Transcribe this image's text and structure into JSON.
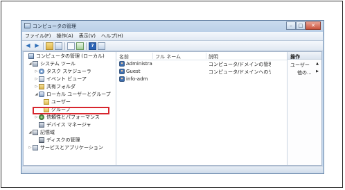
{
  "window": {
    "title": "コンピュータの管理"
  },
  "menu": [
    "ファイル(F)",
    "操作(A)",
    "表示(V)",
    "ヘルプ(H)"
  ],
  "tree": {
    "root": "コンピュータの管理 (ローカル)",
    "system_tools": "システム ツール",
    "task_scheduler": "タスク スケジューラ",
    "event_viewer": "イベント ビューア",
    "shared_folders": "共有フォルダ",
    "local_users_groups": "ローカル ユーザーとグループ",
    "users": "ユーザー",
    "groups": "グループ",
    "reliability": "信頼性とパフォーマンス",
    "device_manager": "デバイス マネージャ",
    "storage": "記憶域",
    "disk_management": "ディスクの管理",
    "services_apps": "サービスとアプリケーション"
  },
  "list": {
    "columns": [
      "名前",
      "フル ネーム",
      "説明"
    ],
    "rows": [
      {
        "name": "Administra...",
        "fullname": "",
        "description": "コンピュータ/ドメインの管理用..."
      },
      {
        "name": "Guest",
        "fullname": "",
        "description": "コンピュータ/ドメインへのゲス..."
      },
      {
        "name": "info-adm",
        "fullname": "",
        "description": ""
      }
    ]
  },
  "actions": {
    "header": "操作",
    "section": "ユーザー",
    "other": "他の..."
  },
  "colors": {
    "highlight": "#d7262e",
    "window_frame": "#b7cde6"
  }
}
